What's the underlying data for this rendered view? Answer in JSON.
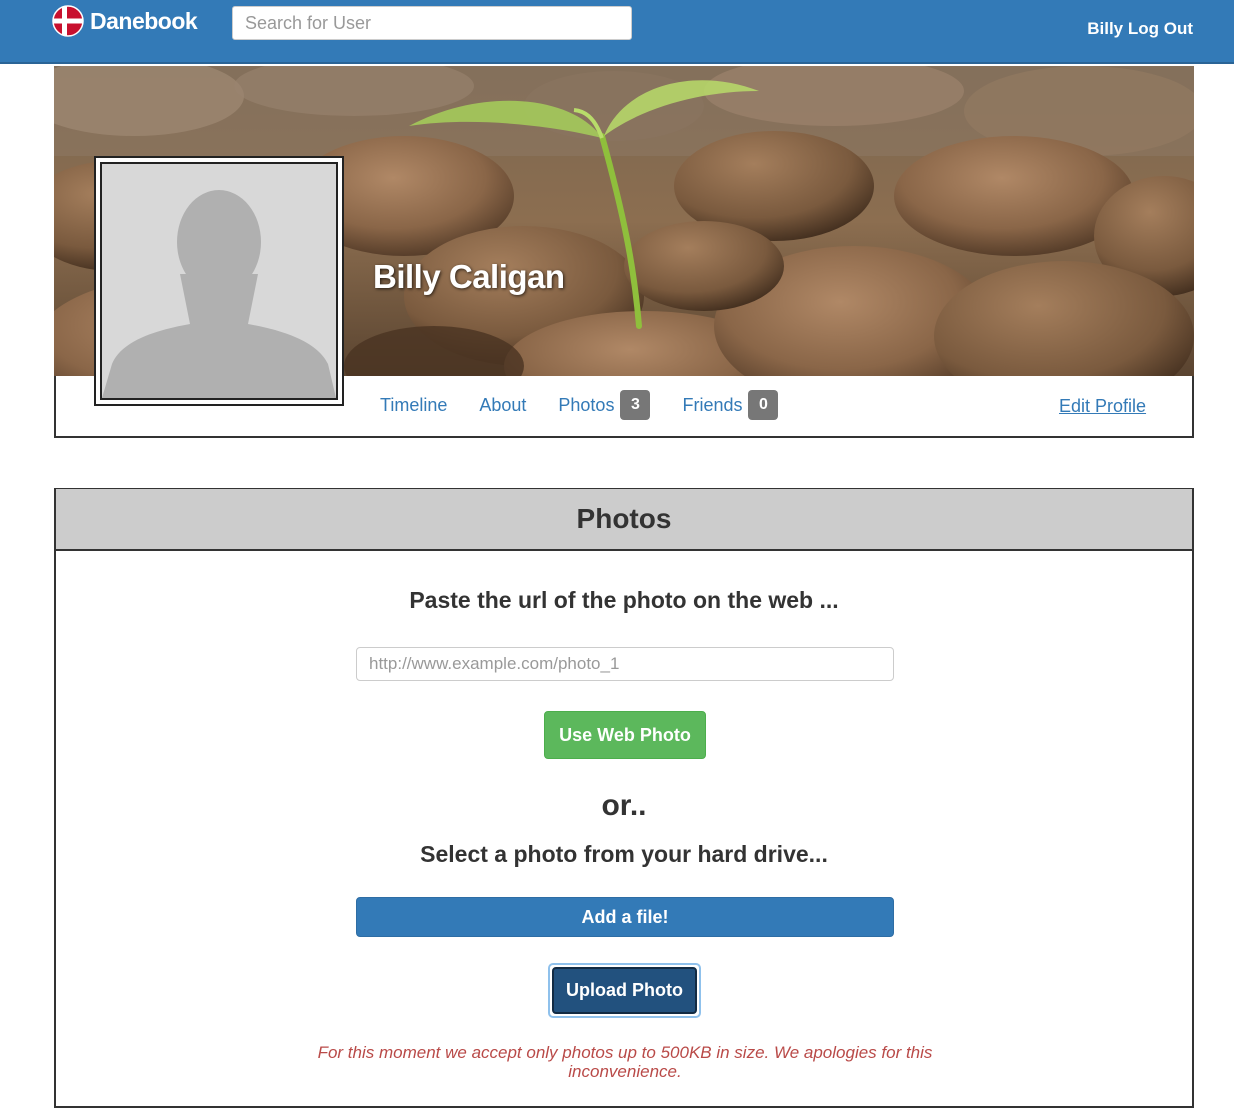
{
  "navbar": {
    "brand": "Danebook",
    "search_placeholder": "Search for User",
    "logout_label": "Billy Log Out",
    "brand_color": "#337ab7"
  },
  "profile": {
    "name": "Billy Caligan",
    "tabs": [
      {
        "label": "Timeline"
      },
      {
        "label": "About"
      },
      {
        "label": "Photos",
        "count": "3"
      },
      {
        "label": "Friends",
        "count": "0"
      }
    ],
    "edit_label": "Edit Profile"
  },
  "photos_panel": {
    "title": "Photos",
    "paste_label": "Paste the url of the photo on the web ...",
    "url_placeholder": "http://www.example.com/photo_1",
    "web_button": "Use Web Photo",
    "or_label": "or..",
    "select_label": "Select a photo from your hard drive...",
    "file_button": "Add a file!",
    "upload_button": "Upload Photo",
    "notice": "For this moment we accept only photos up to 500KB in size. We apologies for this inconvenience."
  },
  "colors": {
    "primary": "#337ab7",
    "success": "#5cb85c",
    "danger_text": "#b94a48",
    "badge": "#777777",
    "panel_heading": "#cccccc"
  },
  "icons": [
    "danish-flag-logo-icon",
    "default-avatar-icon"
  ]
}
